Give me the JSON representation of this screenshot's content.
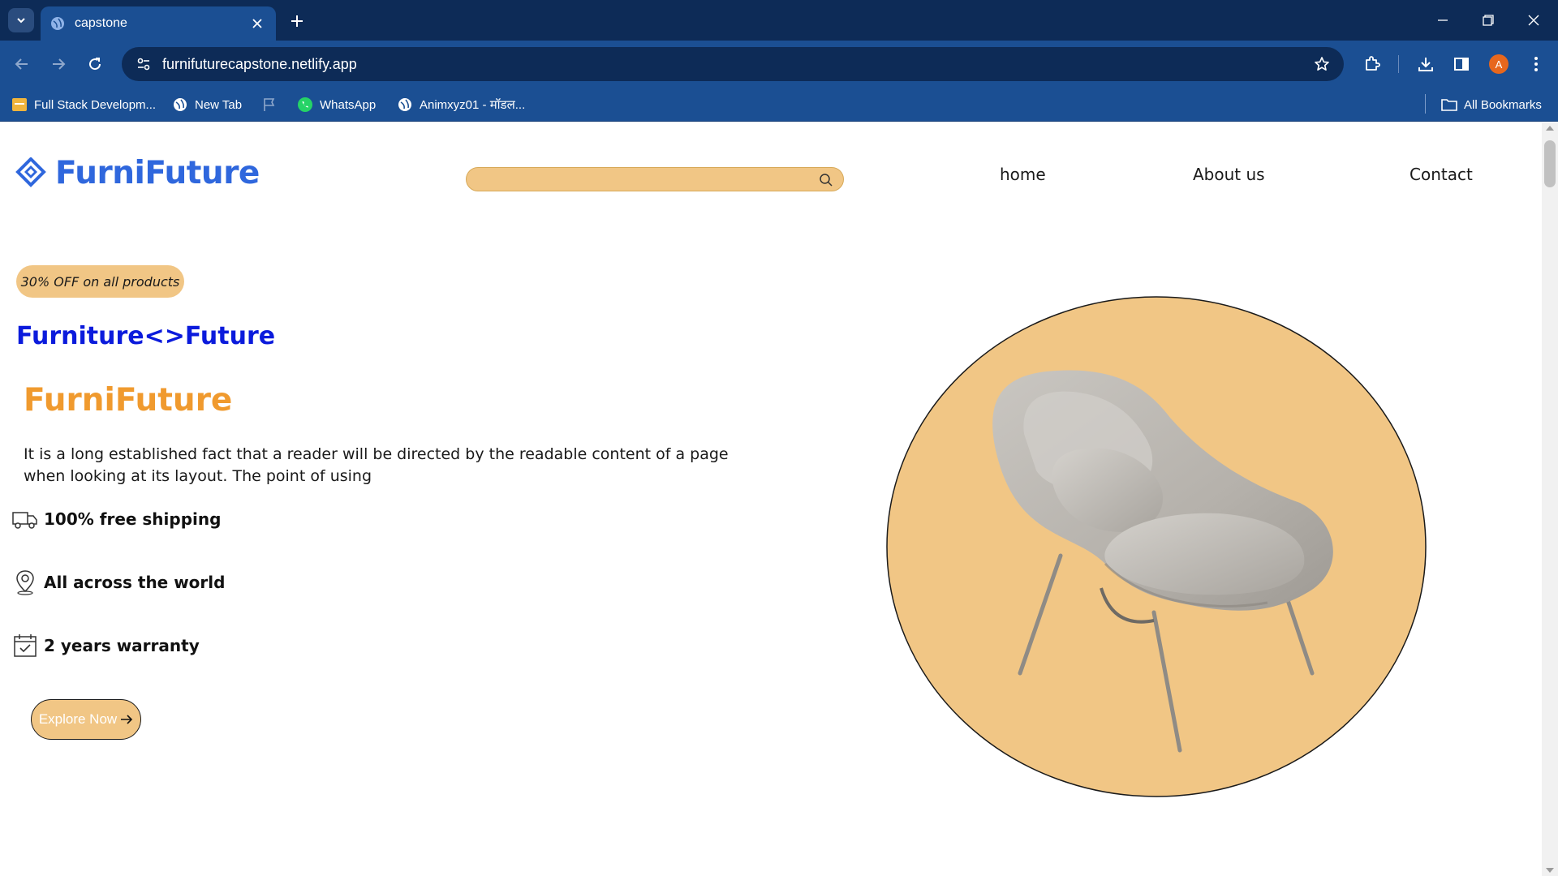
{
  "browser": {
    "tab_title": "capstone",
    "url": "furnifuturecapstone.netlify.app",
    "profile_initial": "A",
    "bookmarks": [
      {
        "label": "Full Stack Developm...",
        "icon": "folder-app-icon"
      },
      {
        "label": "New Tab",
        "icon": "globe-icon"
      },
      {
        "label": "",
        "icon": "flag-icon"
      },
      {
        "label": "WhatsApp",
        "icon": "whatsapp-icon"
      },
      {
        "label": "Animxyz01 - मॉडल...",
        "icon": "globe-icon"
      }
    ],
    "all_bookmarks_label": "All Bookmarks"
  },
  "site": {
    "brand": "FurniFuture",
    "search": {
      "placeholder": "",
      "value": ""
    },
    "nav": [
      {
        "label": "home"
      },
      {
        "label": "About us"
      },
      {
        "label": "Contact"
      }
    ]
  },
  "hero": {
    "promo": "30% OFF on all products",
    "tagline": "Furniture<>Future",
    "title": "FurniFuture",
    "description": "It is a long established fact that a reader will be directed by the readable content of a page when looking at its layout. The point of using",
    "features": [
      {
        "label": "100% free shipping",
        "icon": "truck-icon"
      },
      {
        "label": "All across the world",
        "icon": "location-pin-icon"
      },
      {
        "label": "2 years warranty",
        "icon": "calendar-check-icon"
      }
    ],
    "cta": "Explore Now"
  },
  "colors": {
    "chrome_dark": "#0d2b57",
    "chrome": "#1b4f93",
    "brand_blue": "#2f67dd",
    "tagline_blue": "#0b1bdc",
    "accent_orange": "#f09a2e",
    "sand": "#f1c685"
  }
}
